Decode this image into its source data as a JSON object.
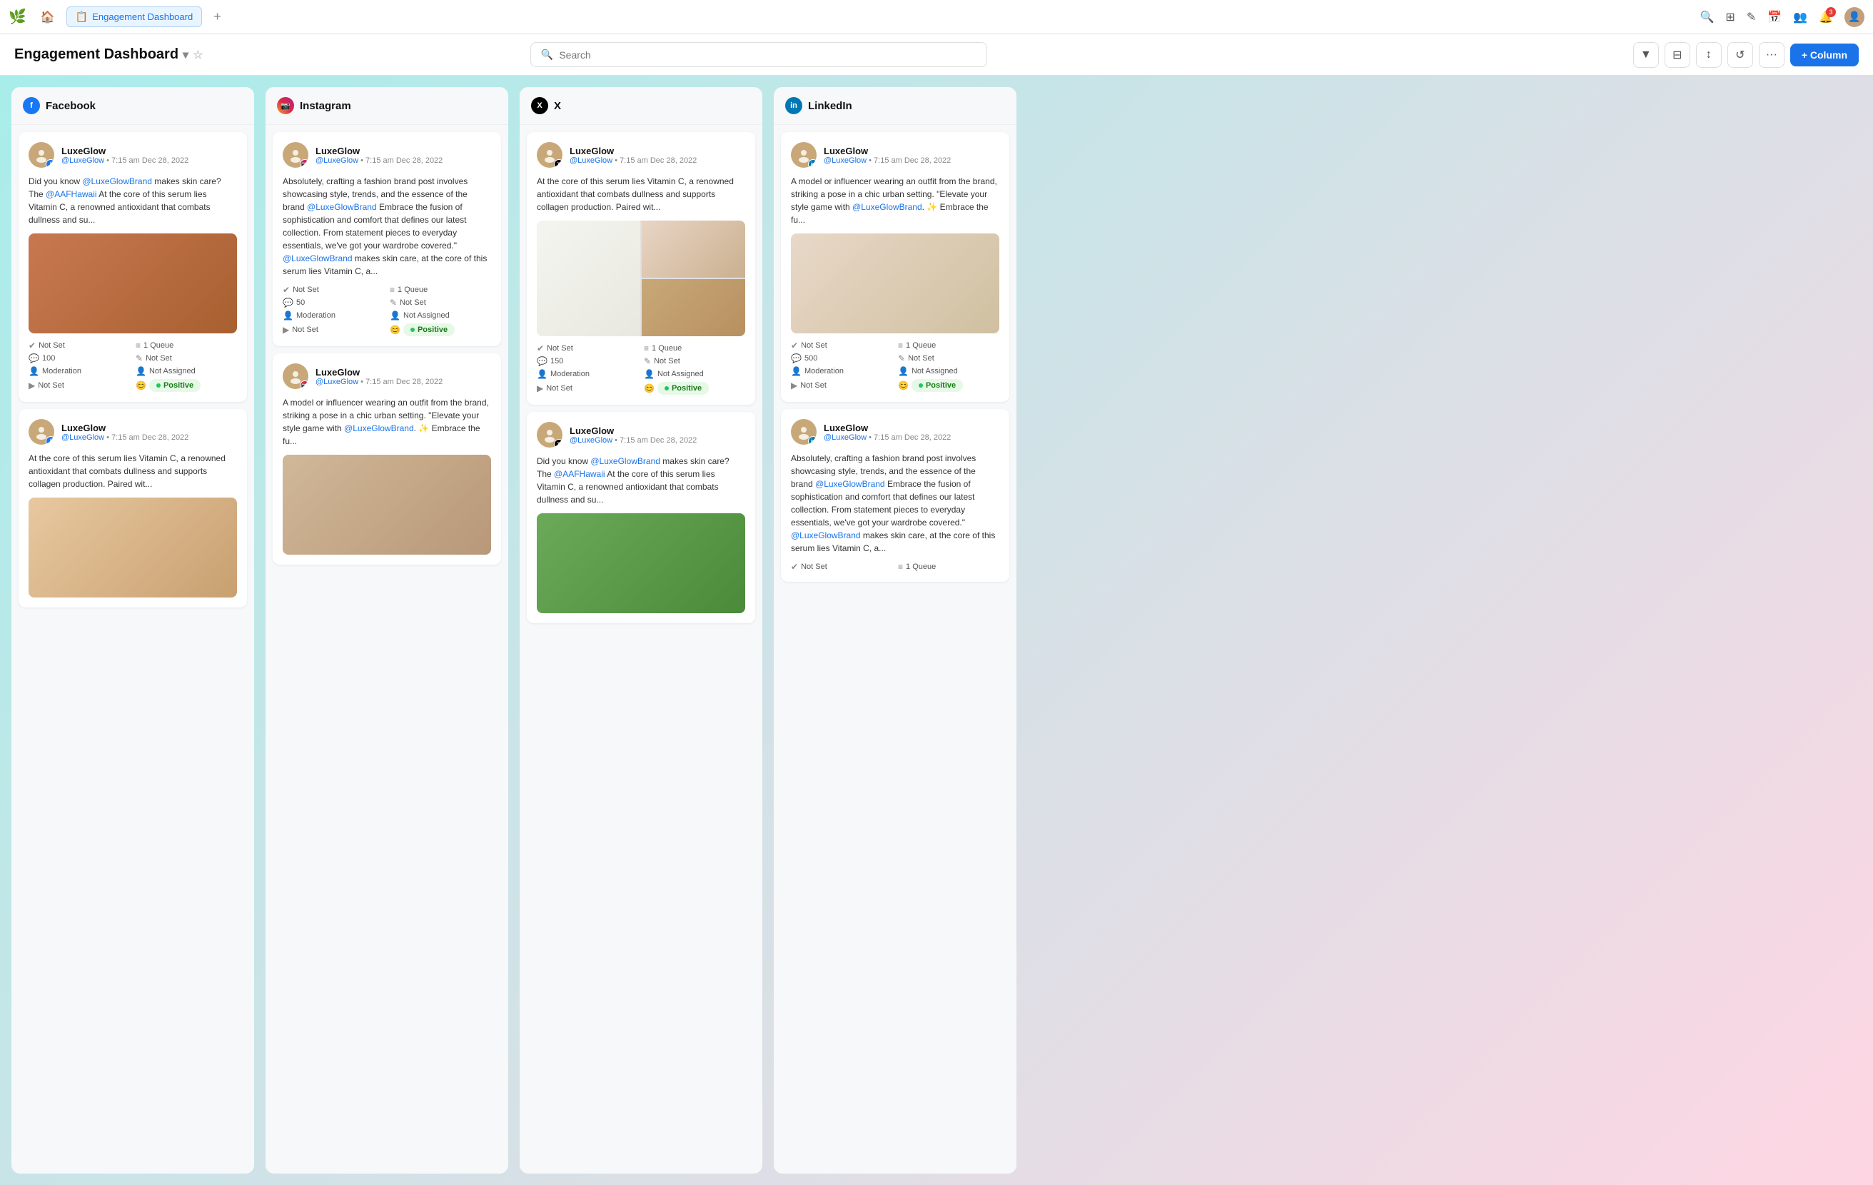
{
  "app": {
    "logo": "🌿",
    "active_tab": "Engagement Dashboard",
    "add_tab": "+"
  },
  "nav": {
    "icons": [
      "🔍",
      "⊞",
      "✎",
      "📅",
      "👤",
      "🔔",
      "👤"
    ],
    "notif_count": "3",
    "search_placeholder": "Search"
  },
  "header": {
    "title": "Engagement Dashboard",
    "search_placeholder": "Search",
    "column_btn": "+ Column"
  },
  "columns": [
    {
      "id": "facebook",
      "name": "Facebook",
      "platform": "fb",
      "cards": [
        {
          "author": "LuxeGlow",
          "handle": "@LuxeGlow",
          "time": "7:15 am Dec 28, 2022",
          "text": "Did you know @LuxeGlowBrand makes skin care? The @AAFHawaii At the core of this serum lies Vitamin C, a renowned antioxidant that combats dullness and su...",
          "has_image": true,
          "image_type": "skin",
          "meta": [
            {
              "icon": "✔",
              "label": "Not Set"
            },
            {
              "icon": "≡",
              "label": "1 Queue"
            },
            {
              "icon": "💬",
              "label": "100"
            },
            {
              "icon": "✎",
              "label": "Not Set"
            },
            {
              "icon": "👤",
              "label": "Moderation"
            },
            {
              "icon": "👤",
              "label": "Not Assigned"
            },
            {
              "icon": "▶",
              "label": "Not Set"
            },
            {
              "icon": "😊",
              "label": "Positive",
              "badge": true
            }
          ]
        },
        {
          "author": "LuxeGlow",
          "handle": "@LuxeGlow",
          "time": "7:15 am Dec 28, 2022",
          "text": "At the core of this serum lies Vitamin C, a renowned antioxidant that combats dullness and supports collagen production. Paired wit...",
          "has_image": true,
          "image_type": "person",
          "meta": []
        }
      ]
    },
    {
      "id": "instagram",
      "name": "Instagram",
      "platform": "ig",
      "cards": [
        {
          "author": "LuxeGlow",
          "handle": "@LuxeGlow",
          "time": "7:15 am Dec 28, 2022",
          "text": "Absolutely, crafting a fashion brand post involves showcasing style, trends, and the essence of the brand @LuxeGlowBrand Embrace the fusion of sophistication and comfort that defines our latest collection. From statement pieces to everyday essentials, we've got your wardrobe covered.\" @LuxeGlowBrand makes skin care, at the core of this serum lies Vitamin C, a...",
          "has_image": false,
          "meta": [
            {
              "icon": "✔",
              "label": "Not Set"
            },
            {
              "icon": "≡",
              "label": "1 Queue"
            },
            {
              "icon": "💬",
              "label": "50"
            },
            {
              "icon": "✎",
              "label": "Not Set"
            },
            {
              "icon": "👤",
              "label": "Moderation"
            },
            {
              "icon": "👤",
              "label": "Not Assigned"
            },
            {
              "icon": "▶",
              "label": "Not Set"
            },
            {
              "icon": "😊",
              "label": "Positive",
              "badge": true
            }
          ]
        },
        {
          "author": "LuxeGlow",
          "handle": "@LuxeGlow",
          "time": "7:15 am Dec 28, 2022",
          "text": "A model or influencer wearing an outfit from the brand, striking a pose in a chic urban setting. \"Elevate your style game with @LuxeGlowBrand. ✨ Embrace the fu...",
          "has_image": true,
          "image_type": "hand",
          "meta": []
        }
      ]
    },
    {
      "id": "x",
      "name": "X",
      "platform": "x",
      "cards": [
        {
          "author": "LuxeGlow",
          "handle": "@LuxeGlow",
          "time": "7:15 am Dec 28, 2022",
          "text": "At the core of this serum lies Vitamin C, a renowned antioxidant that combats dullness and supports collagen production. Paired wit...",
          "has_image": true,
          "image_type": "grid3",
          "meta": [
            {
              "icon": "✔",
              "label": "Not Set"
            },
            {
              "icon": "≡",
              "label": "1 Queue"
            },
            {
              "icon": "💬",
              "label": "150"
            },
            {
              "icon": "✎",
              "label": "Not Set"
            },
            {
              "icon": "👤",
              "label": "Moderation"
            },
            {
              "icon": "👤",
              "label": "Not Assigned"
            },
            {
              "icon": "▶",
              "label": "Not Set"
            },
            {
              "icon": "😊",
              "label": "Positive",
              "badge": true
            }
          ]
        },
        {
          "author": "LuxeGlow",
          "handle": "@LuxeGlow",
          "time": "7:15 am Dec 28, 2022",
          "text": "Did you know @LuxeGlowBrand makes skin care? The @AAFHawaii At the core of this serum lies Vitamin C, a renowned antioxidant that combats dullness and su...",
          "has_image": true,
          "image_type": "nature",
          "meta": []
        }
      ]
    },
    {
      "id": "linkedin",
      "name": "LinkedIn",
      "platform": "li",
      "cards": [
        {
          "author": "LuxeGlow",
          "handle": "@LuxeGlow",
          "time": "7:15 am Dec 28, 2022",
          "text": "A model or influencer wearing an outfit from the brand, striking a pose in a chic urban setting. \"Elevate your style game with @LuxeGlowBrand. ✨ Embrace the fu...",
          "has_image": true,
          "image_type": "foam",
          "meta": [
            {
              "icon": "✔",
              "label": "Not Set"
            },
            {
              "icon": "≡",
              "label": "1 Queue"
            },
            {
              "icon": "💬",
              "label": "500"
            },
            {
              "icon": "✎",
              "label": "Not Set"
            },
            {
              "icon": "👤",
              "label": "Moderation"
            },
            {
              "icon": "👤",
              "label": "Not Assigned"
            },
            {
              "icon": "▶",
              "label": "Not Set"
            },
            {
              "icon": "😊",
              "label": "Positive",
              "badge": true
            }
          ]
        },
        {
          "author": "LuxeGlow",
          "handle": "@LuxeGlow",
          "time": "7:15 am Dec 28, 2022",
          "text": "Absolutely, crafting a fashion brand post involves showcasing style, trends, and the essence of the brand @LuxeGlowBrand Embrace the fusion of sophistication and comfort that defines our latest collection. From statement pieces to everyday essentials, we've got your wardrobe covered.\" @LuxeGlowBrand makes skin care, at the core of this serum lies Vitamin C, a...",
          "has_image": false,
          "meta": [
            {
              "icon": "✔",
              "label": "Not Set"
            },
            {
              "icon": "≡",
              "label": "1 Queue"
            }
          ]
        }
      ]
    }
  ]
}
